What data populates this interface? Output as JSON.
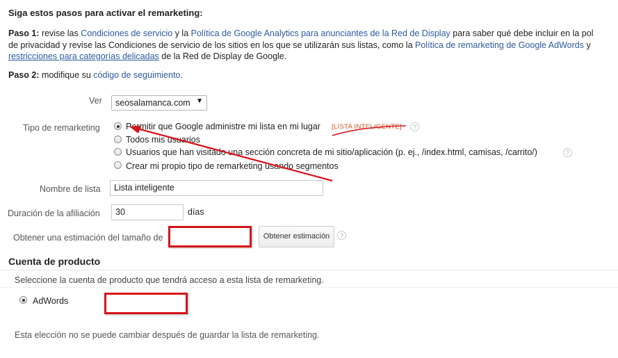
{
  "header": {
    "title": "Siga estos pasos para activar el remarketing:"
  },
  "step1": {
    "label": "Paso 1:",
    "t1": " revise las ",
    "link_terms": "Condiciones de servicio",
    "t2": " y la ",
    "link_policy": "Política de Google Analytics para anunciantes de la Red de Display",
    "t3": " para saber qué debe incluir en la pol",
    "t4": "de privacidad y revise las Condiciones de servicio de los sitios en los que se utilizarán sus listas, como la ",
    "link_adwords_policy": "Política de remarketing de Google AdWords",
    "t5": " y",
    "link_restrictions": "restricciones para categorías delicadas",
    "t6": " de la Red de Display de Google."
  },
  "step2": {
    "label": "Paso 2:",
    "t1": " modifique su ",
    "link_code": "código de seguimiento",
    "t2": "."
  },
  "form": {
    "ver_label": "Ver",
    "ver_value": "seosalamanca.com",
    "tipo_label": "Tipo de remarketing",
    "options": [
      "Permitir que Google administre mi lista en mi lugar",
      "Todos mis usuarios",
      "Usuarios que han visitado una sección concreta de mi sitio/aplicación (p. ej., /index.html, camisas, /carrito/)",
      "Crear mi propio tipo de remarketing usando segmentos"
    ],
    "smart_tag": "[LISTA INTELIGENTE]",
    "help_glyph": "?",
    "nombre_label": "Nombre de lista",
    "nombre_value": "Lista inteligente",
    "duracion_label": "Duración de la afiliación",
    "duracion_value": "30",
    "duracion_unit": "días",
    "estimacion_label": "Obtener una estimación del tamaño de",
    "estimacion_button": "Obtener estimación"
  },
  "product": {
    "section_title": "Cuenta de producto",
    "description": "Seleccione la cuenta de producto que tendrá acceso a esta lista de remarketing.",
    "option": "AdWords",
    "note": "Esta elección no se puede cambiar después de guardar la lista de remarketing."
  },
  "colors": {
    "link": "#2c5aa0",
    "annotation_red": "#d7141a",
    "tag_orange": "#d14d1b"
  }
}
